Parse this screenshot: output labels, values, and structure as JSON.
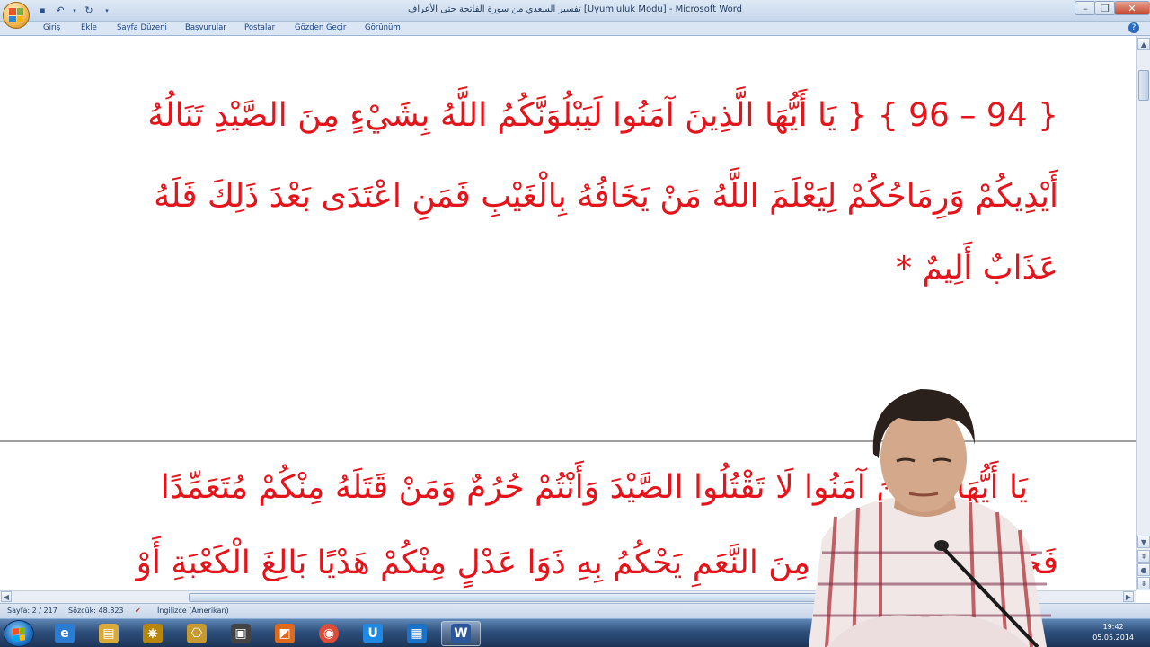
{
  "window": {
    "title": "تفسير السعدي من سورة الفاتحة حتى الأعراف [Uyumluluk Modu] - Microsoft Word",
    "minimize_label": "–",
    "restore_label": "❐",
    "close_label": "✕"
  },
  "quick_access": {
    "save_icon": "save-icon",
    "undo_icon": "undo-icon",
    "redo_icon": "redo-icon",
    "customize_icon": "dropdown-icon"
  },
  "ribbon": {
    "tabs": [
      {
        "label": "Giriş"
      },
      {
        "label": "Ekle"
      },
      {
        "label": "Sayfa Düzeni"
      },
      {
        "label": "Başvurular"
      },
      {
        "label": "Postalar"
      },
      {
        "label": "Gözden Geçir"
      },
      {
        "label": "Görünüm"
      }
    ],
    "help_label": "?"
  },
  "document": {
    "text_color": "#e5141a",
    "lines": [
      "{ 94 – 96 } { يَا أَيُّهَا الَّذِينَ آمَنُوا لَيَبْلُوَنَّكُمُ اللَّهُ بِشَيْءٍ مِنَ الصَّيْدِ تَنَالُهُ",
      "أَيْدِيكُمْ وَرِمَاحُكُمْ لِيَعْلَمَ اللَّهُ مَنْ يَخَافُهُ بِالْغَيْبِ فَمَنِ اعْتَدَى بَعْدَ ذَلِكَ فَلَهُ",
      "عَذَابٌ أَلِيمٌ *",
      "يَا أَيُّهَا الَّذِينَ آمَنُوا لَا تَقْتُلُوا الصَّيْدَ وَأَنْتُمْ حُرُمٌ وَمَنْ قَتَلَهُ مِنْكُمْ مُتَعَمِّدًا",
      "فَجَزَاءٌ مِثْلُ مَا قَتَلَ مِنَ النَّعَمِ يَحْكُمُ بِهِ ذَوَا عَدْلٍ مِنْكُمْ هَدْيًا بَالِغَ الْكَعْبَةِ أَوْ"
    ]
  },
  "status": {
    "page": "Sayfa: 2 / 217",
    "words": "Sözcük: 48.823",
    "language": "İngilizce (Amerikan)"
  },
  "taskbar": {
    "items": [
      {
        "name": "internet-explorer",
        "glyph": "e",
        "color": "#2b7cd3"
      },
      {
        "name": "file-explorer",
        "glyph": "▤",
        "color": "#d9a93a"
      },
      {
        "name": "app-3",
        "glyph": "⎈",
        "color": "#b8860b"
      },
      {
        "name": "app-4",
        "glyph": "⎔",
        "color": "#c69a2e"
      },
      {
        "name": "app-5",
        "glyph": "▣",
        "color": "#444444"
      },
      {
        "name": "app-6",
        "glyph": "◩",
        "color": "#e06a1b"
      },
      {
        "name": "chrome",
        "glyph": "◉",
        "color": "#dd4b39"
      },
      {
        "name": "app-u",
        "glyph": "U",
        "color": "#1e88e5"
      },
      {
        "name": "app-9",
        "glyph": "▦",
        "color": "#1a73c8"
      },
      {
        "name": "microsoft-word",
        "glyph": "W",
        "color": "#2b579a"
      }
    ],
    "time": "19:42",
    "date": "05.05.2014"
  }
}
